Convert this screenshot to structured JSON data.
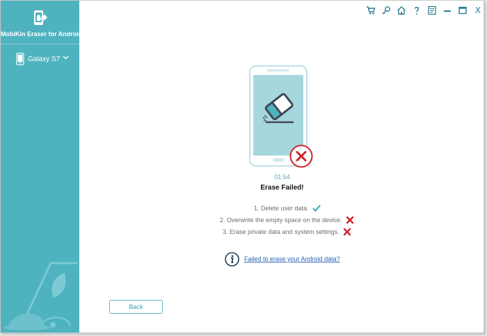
{
  "app": {
    "title": "MobiKin Eraser for Android",
    "logo_icon": "android-eraser-icon",
    "accent_color": "#4fb3bf"
  },
  "sidebar": {
    "device_name": "Galaxy S7",
    "device_icon": "phone-icon"
  },
  "toolbar": {
    "icons": [
      "cart-icon",
      "key-icon",
      "home-icon",
      "help-icon",
      "feedback-icon",
      "minimize-icon",
      "maximize-icon",
      "close-icon"
    ],
    "close_label": "X"
  },
  "main": {
    "timer": "01:54",
    "status_title": "Erase Failed!",
    "steps": [
      {
        "label": "1. Delete user data.",
        "status": "success"
      },
      {
        "label": "2. Overwrite the empty space on the device.",
        "status": "failed"
      },
      {
        "label": "3. Erase private data and system settings.",
        "status": "failed"
      }
    ],
    "help_link": "Failed to erase your Android data?",
    "back_label": "Back"
  },
  "colors": {
    "success": "#4aa7b9",
    "failed": "#d0202a",
    "link": "#2a63b0"
  }
}
